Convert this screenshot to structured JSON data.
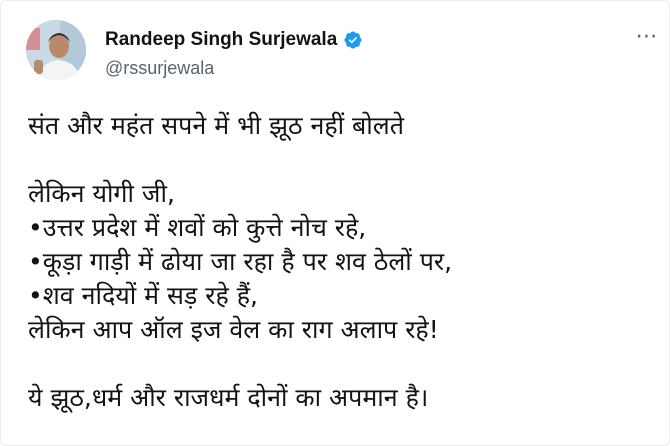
{
  "tweet": {
    "author": {
      "display_name": "Randeep Singh Surjewala",
      "handle": "@rssurjewala",
      "verified": true
    },
    "more_icon": "more-horizontal-icon",
    "lines": {
      "l1": "संत और महंत सपने में भी झूठ नहीं बोलते",
      "l2": "लेकिन योगी जी,",
      "l3": "•उत्तर प्रदेश में शवों को कुत्ते नोच रहे,",
      "l4": "•कूड़ा गाड़ी में ढोया जा रहा है पर शव ठेलों पर,",
      "l5": "•शव नदियों में सड़ रहे हैं,",
      "l6": "लेकिन आप ऑल इज वेल का राग अलाप रहे!",
      "l7": "ये झूठ,धर्म और राजधर्म दोनों का अपमान है।"
    },
    "colors": {
      "text": "#0f1419",
      "secondary": "#536471",
      "verified": "#1d9bf0"
    }
  }
}
